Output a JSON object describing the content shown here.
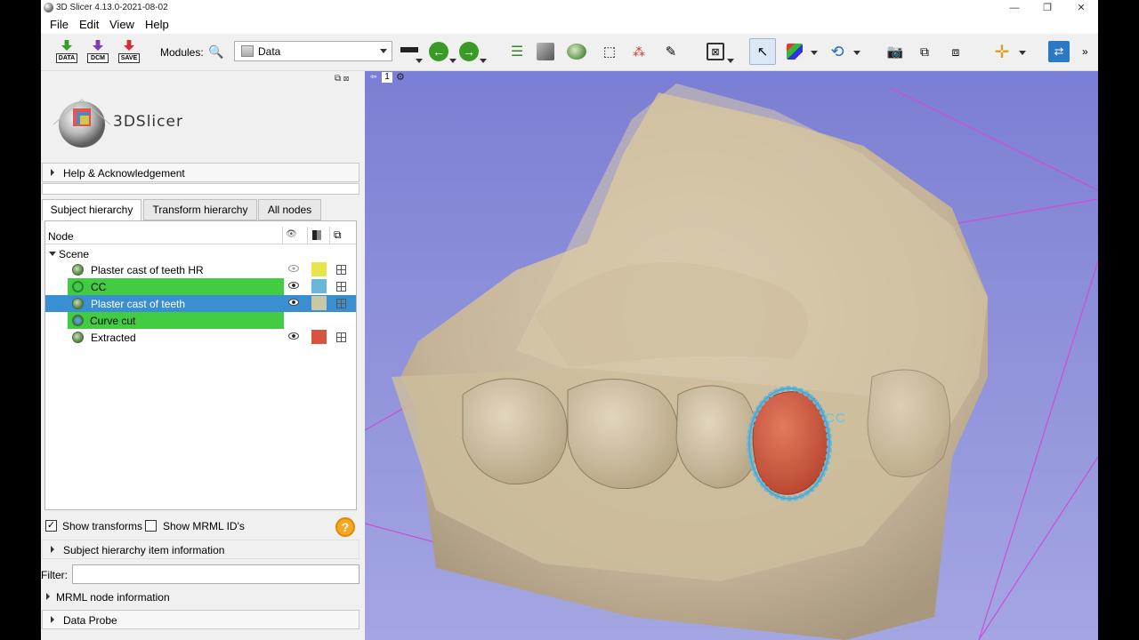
{
  "window": {
    "title": "3D Slicer 4.13.0-2021-08-02",
    "minimize": "—",
    "maximize": "❐",
    "close": "✕"
  },
  "menu": [
    "File",
    "Edit",
    "View",
    "Help"
  ],
  "toolbar": {
    "load_data": "DATA",
    "load_dicom": "DCM",
    "save": "SAVE",
    "modules_label": "Modules:",
    "module_selected": "Data",
    "overflow": "»"
  },
  "logo": {
    "text": "3DSlicer"
  },
  "sections": {
    "help": "Help & Acknowledgement",
    "item_info": "Subject hierarchy item information",
    "mrml_info": "MRML node information",
    "data_probe": "Data Probe"
  },
  "tabs": [
    "Subject hierarchy",
    "Transform hierarchy",
    "All nodes"
  ],
  "tree": {
    "header_node": "Node",
    "scene": "Scene",
    "items": [
      {
        "label": "Plaster cast of teeth HR",
        "color": "#e8e44a",
        "visible": false,
        "highlight": ""
      },
      {
        "label": "CC",
        "color": "#6ab7d8",
        "visible": true,
        "highlight": "#41cc41"
      },
      {
        "label": "Plaster cast of teeth",
        "color": "#c9c7a6",
        "visible": true,
        "highlight": "#3a8fd0"
      },
      {
        "label": "Curve cut",
        "color": "",
        "visible": null,
        "highlight": "#41cc41"
      },
      {
        "label": "Extracted",
        "color": "#d6553f",
        "visible": true,
        "highlight": ""
      }
    ]
  },
  "options": {
    "show_transforms": "Show transforms",
    "show_transforms_checked": true,
    "show_mrml_ids": "Show MRML ID's",
    "show_mrml_ids_checked": false
  },
  "filter": {
    "label": "Filter:",
    "value": ""
  },
  "view3d": {
    "view_number": "1",
    "curve_label": "CC",
    "background_top": "#7c7fd2",
    "background_bottom": "#a4a6e3",
    "box_color": "#d04bd8",
    "model_color": "#cbbb9b",
    "extracted_color": "#d6553f",
    "curve_color": "#6ab7d8"
  }
}
